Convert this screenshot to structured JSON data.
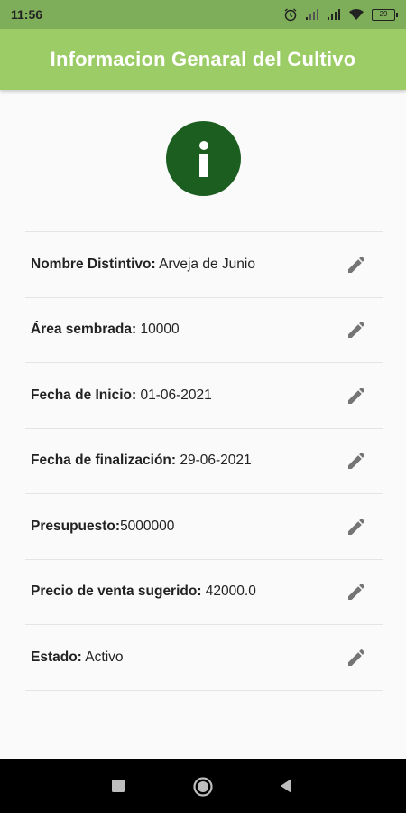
{
  "status_bar": {
    "time": "11:56",
    "battery": "29",
    "icons": [
      "alarm-icon",
      "signal-icon",
      "signal-icon",
      "wifi-icon",
      "battery-icon"
    ]
  },
  "app_bar": {
    "title": "Informacion Genaral del Cultivo"
  },
  "info_icon": "info-icon",
  "fields": [
    {
      "label": "Nombre Distintivo:",
      "value": " Arveja de Junio"
    },
    {
      "label": "Área sembrada:",
      "value": " 10000"
    },
    {
      "label": "Fecha de Inicio:",
      "value": " 01-06-2021"
    },
    {
      "label": "Fecha de finalización:",
      "value": " 29-06-2021"
    },
    {
      "label": "Presupuesto:",
      "value": "5000000"
    },
    {
      "label": "Precio de venta sugerido:",
      "value": " 42000.0"
    },
    {
      "label": "Estado:",
      "value": " Activo"
    }
  ],
  "colors": {
    "status_bar": "#7fae5a",
    "app_bar": "#9ccc65",
    "info_badge": "#1b5e20",
    "edit_icon": "#757575"
  }
}
